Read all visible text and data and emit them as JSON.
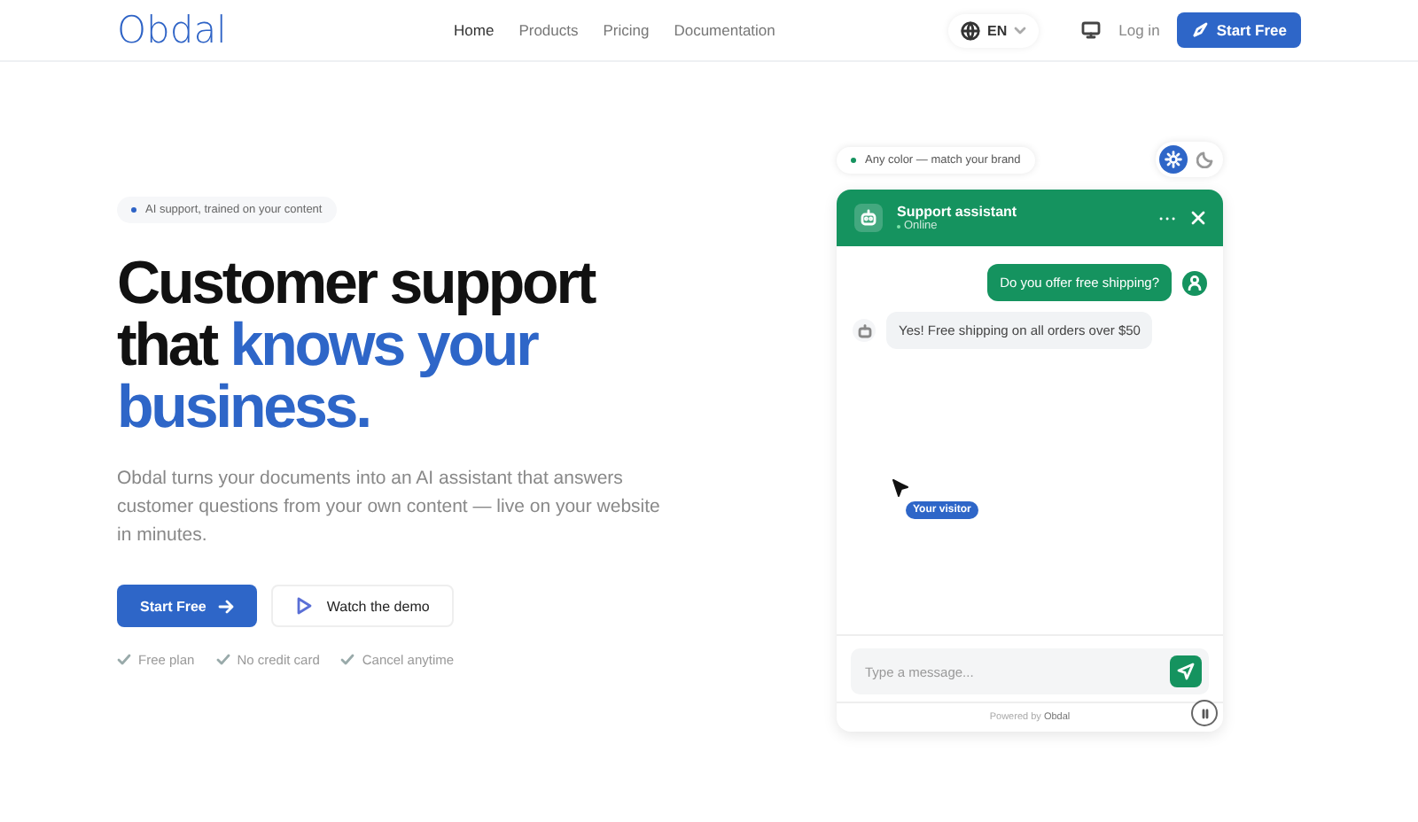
{
  "header": {
    "logo": "Obdal",
    "nav": [
      {
        "label": "Home",
        "selected": true
      },
      {
        "label": "Products",
        "selected": false
      },
      {
        "label": "Pricing",
        "selected": false
      },
      {
        "label": "Documentation",
        "selected": false
      }
    ],
    "language": "EN",
    "login": "Log in",
    "cta": "Start Free"
  },
  "hero": {
    "badge": "AI support, trained on your content",
    "headline": [
      [
        {
          "text": "Customer support",
          "accent": false
        }
      ],
      [
        {
          "text": "that ",
          "accent": false
        },
        {
          "text": "knows your",
          "accent": true
        }
      ],
      [
        {
          "text": "business.",
          "accent": true
        }
      ]
    ],
    "description": "Obdal turns your documents into an AI assistant that answers customer questions from your own content — live on your website in minutes.",
    "primary_button": "Start Free",
    "secondary_button": "Watch the demo",
    "perks": [
      "Free plan",
      "No credit card",
      "Cancel anytime"
    ]
  },
  "demo": {
    "hint": "Any color — match your brand",
    "theme_toggle": [
      {
        "kind": "light",
        "selected": true
      },
      {
        "kind": "dark",
        "selected": false
      }
    ],
    "chat": {
      "title": "Support assistant",
      "status": "Online",
      "color": "#15935f",
      "messages": [
        {
          "kind": "user",
          "text": "Do you offer free shipping?"
        },
        {
          "kind": "bot",
          "text": "Yes! Free shipping on all orders over $50"
        }
      ],
      "visitor_tag": "Your visitor",
      "input_placeholder": "Type a message...",
      "footer": "Powered by **Obdal**"
    }
  }
}
